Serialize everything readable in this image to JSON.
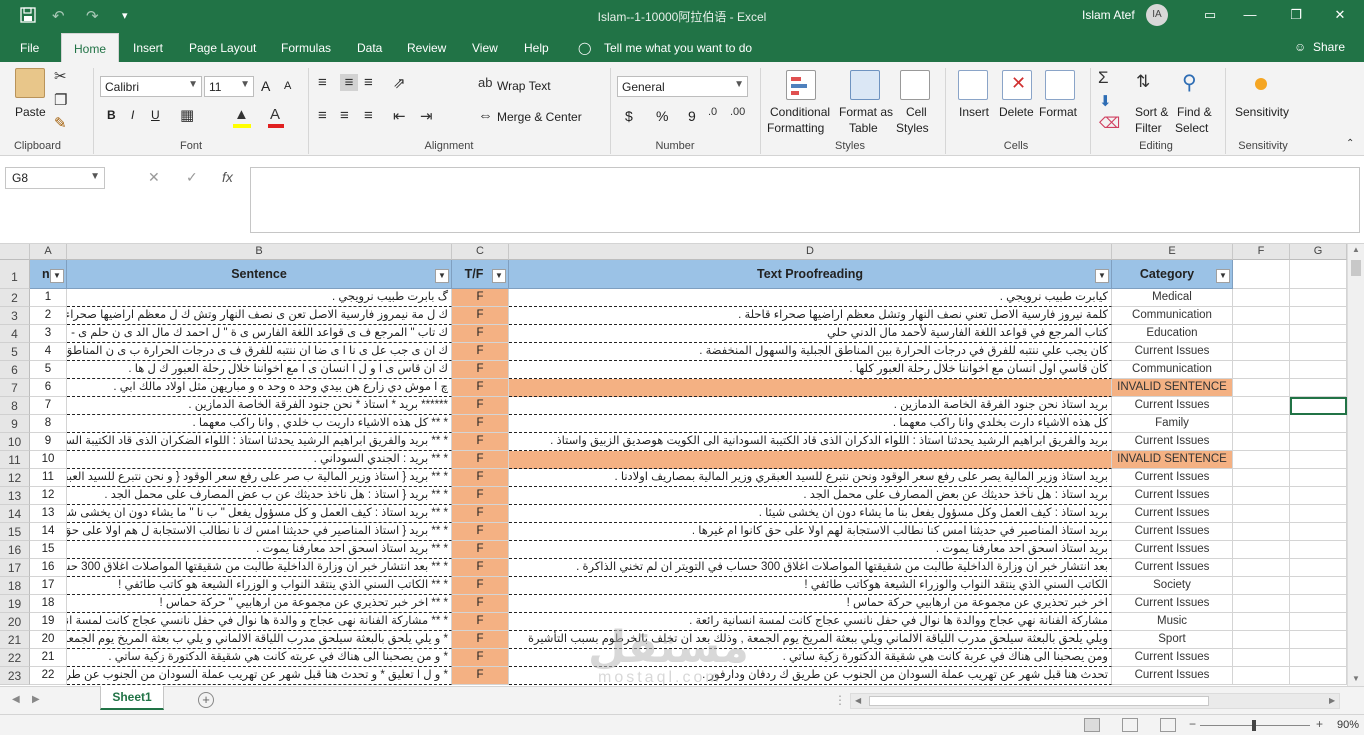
{
  "window": {
    "title": "Islam--1-10000阿拉伯语  -  Excel",
    "user": "Islam Atef",
    "avatar": "IA",
    "minimize": "—",
    "restore": "❐",
    "close": "✕",
    "ribbon_toggle": "▭"
  },
  "quick_access": {
    "save_icon": "save-icon",
    "undo": "↶",
    "redo": "↷",
    "more": "▾"
  },
  "tabs": [
    "File",
    "Home",
    "Insert",
    "Page Layout",
    "Formulas",
    "Data",
    "Review",
    "View",
    "Help"
  ],
  "tell_me": "Tell me what you want to do",
  "share": "Share",
  "ribbon": {
    "clipboard": {
      "paste": "Paste",
      "label": "Clipboard"
    },
    "font": {
      "name": "Calibri",
      "size": "11",
      "label": "Font",
      "bold": "B",
      "italic": "I",
      "underline": "U",
      "grow": "A",
      "shrink": "A"
    },
    "alignment": {
      "wrap": "Wrap Text",
      "merge": "Merge & Center",
      "label": "Alignment"
    },
    "number": {
      "format": "General",
      "currency": "$",
      "percent": "%",
      "comma": "9",
      "label": "Number"
    },
    "styles": {
      "conditional_1": "Conditional",
      "conditional_2": "Formatting",
      "format_table_1": "Format as",
      "format_table_2": "Table",
      "cell_styles_1": "Cell",
      "cell_styles_2": "Styles",
      "label": "Styles"
    },
    "cells": {
      "insert": "Insert",
      "delete": "Delete",
      "format": "Format",
      "label": "Cells"
    },
    "editing": {
      "sort_1": "Sort &",
      "sort_2": "Filter",
      "find_1": "Find &",
      "find_2": "Select",
      "label": "Editing"
    },
    "sensitivity": {
      "button": "Sensitivity",
      "label": "Sensitivity"
    }
  },
  "formula_bar": {
    "name_box": "G8",
    "cancel": "✕",
    "enter": "✓",
    "fx": "fx",
    "formula": ""
  },
  "columns": [
    "A",
    "B",
    "C",
    "D",
    "E",
    "F",
    "G"
  ],
  "table_headers": {
    "a": "n",
    "b": "Sentence",
    "c": "T/F",
    "d": "Text Proofreading",
    "e": "Category"
  },
  "row_numbers": [
    "1",
    "2",
    "3",
    "4",
    "5",
    "6",
    "7",
    "8",
    "9",
    "10",
    "11",
    "12",
    "13",
    "14",
    "15",
    "16",
    "17",
    "18",
    "19",
    "20",
    "21",
    "22",
    "23"
  ],
  "rows": [
    {
      "n": "1",
      "sentence": "گ بابرت طبيب نرويجي .",
      "tf": "F",
      "proof": "كيابرت طبيب نرويجي .",
      "category": "Medical"
    },
    {
      "n": "2",
      "sentence": "ك ل مة نيمروز فارسية الاصل تعن ى نصف النهار وتش ك ل معظم اراضيها صحراء قاحلة",
      "tf": "F",
      "proof": "كلمة نيروز فارسية الاصل تعني نصف النهار وتشل معظم اراضيها صحراء قاحلة .",
      "category": "Communication"
    },
    {
      "n": "3",
      "sentence": "ك تاب \" المرجع ف ى قواعد اللغة الفارس ى ة \" ل احمد ك مال الد ى ن حلم ى -",
      "tf": "F",
      "proof": "كتاب المرجع في قواعد اللغة الفارسية لأحمد مال الدني حلي",
      "category": "Education"
    },
    {
      "n": "4",
      "sentence": "ك ان ى جب عل ى نا ا ى ضا ان ننتبه للفرق ف ى درجات الحرارة ب ى ن المناطق الجبل",
      "tf": "F",
      "proof": "كان يجب علي ننتبه للفرق في درجات الحرارة بين المناطق الجبلية والسهول المنخفضة .",
      "category": "Current Issues"
    },
    {
      "n": "5",
      "sentence": "ك ان قاس ى ا و ل ا انسان ى ا مع اخواننا خلال رحلة العبور ك ل ها .",
      "tf": "F",
      "proof": "كان قاسي اول انسان مع اخواننا خلال رحلة العبور كلها .",
      "category": "Communication"
    },
    {
      "n": "6",
      "sentence": "چ ا موش دي زارع هن بيدي وحد ه وحد ه و مباريهن مثل اولاد مالك ابي .",
      "tf": "F",
      "proof": "",
      "category": "INVALID SENTENCE"
    },
    {
      "n": "7",
      "sentence": "****** بريد * استاذ * نحن جنود الفرقة الخاصة الدمازين .",
      "tf": "F",
      "proof": "بريد استاذ نحن جنود الفرقة الخاصة الدمازين .",
      "category": "Current Issues"
    },
    {
      "n": "8",
      "sentence": "* ** كل هذه الاشياء داريت ب خلدي , وانا راكب معهما .",
      "tf": "F",
      "proof": "كل هذه الاشياء دارت بخلدي وانا راكب معهما .",
      "category": "Family"
    },
    {
      "n": "9",
      "sentence": "* ** بريد والفريق ابراهيم الرشيد يحدثنا استاذ : اللواء الضكران الذى قاد الكتيبة السودانية ال",
      "tf": "F",
      "proof": "بريد والفريق ابراهيم الرشيد يحدثنا استاذ : اللواء الدكران الذى قاد الكتيبة السودانية الى الكويت هوصديق الزبيق واستاذ .",
      "category": "Current Issues"
    },
    {
      "n": "10",
      "sentence": "* ** بريد : الجندي السوداني .",
      "tf": "F",
      "proof": "",
      "category": "INVALID SENTENCE"
    },
    {
      "n": "11",
      "sentence": "* ** بريد { استاذ وزير المالية ب صر على رفع سعر الوقود { و نحن نتبرع للسيد العبقري وزير",
      "tf": "F",
      "proof": "بريد استاذ وزير المالية يصر على رفع سعر الوقود ونحن نتبرع للسيد العبقري وزير المالية بمصاريف اولادنا .",
      "category": "Current Issues"
    },
    {
      "n": "12",
      "sentence": "* ** بريد { استاذ : هل ناخذ حديثك عن ب عض المصارف على محمل الجد .",
      "tf": "F",
      "proof": "بريد استاذ : هل نأخذ حديثك عن بعض المصارف على محمل الجد .",
      "category": "Current Issues"
    },
    {
      "n": "13",
      "sentence": "* ** بريد استاذ : كيف العمل و كل مسؤول يفعل \" ب نا \" ما يشاء دون ان يخشى شيئا .",
      "tf": "F",
      "proof": "بريد استاذ : كيف العمل وكل مسؤول يفعل بنا ما يشاء دون ان يخشى شيئا .",
      "category": "Current Issues"
    },
    {
      "n": "14",
      "sentence": "* ** بريد { استاذ المناصير في حديثنا امس ك نا نطالب الاستجابة ل هم اولا على حق كانوا ام",
      "tf": "F",
      "proof": "بريد استاذ المناصير في حديثنا امس كنا نطالب الاستجابة لهم اولا على حق كانوا ام غيرها .",
      "category": "Current Issues"
    },
    {
      "n": "15",
      "sentence": "* ** بريد استاذ اسحق احد معارفنا يموت .",
      "tf": "F",
      "proof": "بريد استاذ اسحق احد معارفنا يموت .",
      "category": "Current Issues"
    },
    {
      "n": "16",
      "sentence": "* ** بعد انتشار خبر ان وزارة الداخلية طالبت من شقيقتها المواصلات اغلاق 300 حساب",
      "tf": "F",
      "proof": "بعد انتشار خبر ان وزارة الداخلية طالبت من شقيقتها المواصلات اغلاق 300 حساب في التويتر ان لم تخني الذاكرة .",
      "category": "Current Issues"
    },
    {
      "n": "17",
      "sentence": "* ** الكاتب السني الذي ينتقد النواب و الوزراء الشيعة هو كاتب طائفي !",
      "tf": "F",
      "proof": "الكاتب السني الذي ينتقد النواب والوزراء الشيعة هوكاتب طائفي !",
      "category": "Society"
    },
    {
      "n": "18",
      "sentence": "* ** اخر خبر تحذيري عن مجموعة من ارهابيي \" حركة حماس !",
      "tf": "F",
      "proof": "اخر خبر تحذيري عن مجموعة من ارهابيي حركة حماس !",
      "category": "Current Issues"
    },
    {
      "n": "19",
      "sentence": "* ** مشاركة الفنانة نهى عجاج و والدة ها نوال في حفل نانسي عجاج كانت لمسة انسانية رائعة",
      "tf": "F",
      "proof": "مشاركة الفنانة نهي عجاج ووالدة ها نوال في حفل نانسي عجاج كانت لمسة انسانية رائعة .",
      "category": "Music"
    },
    {
      "n": "20",
      "sentence": "* و يلي يلحق بالبعثة سيلحق مدرب اللياقة الالماني و يلي ب بعثة المريخ يوم الجمعة , و ذ",
      "tf": "F",
      "proof": "ويلي يلحق بالبعثة سيلحق مدرب اللياقة الالماني ويلي ببعثة المريخ يوم الجمعة , وذلك بعد ان تخلف بالخرطوم بسبب التأشيرة",
      "category": "Sport"
    },
    {
      "n": "21",
      "sentence": "* و من يصحبنا الى هناك في عربته كانت هي شقيقة الدكتورة زكية ساتي .",
      "tf": "F",
      "proof": "ومن يصحبنا الى هناك في عربة كانت هي شقيقة الدكتورة زكية ساتي .",
      "category": "Current Issues"
    },
    {
      "n": "22",
      "sentence": "* و ل ا تعليق * و تحدث هنا قبل شهر عن تهريب عملة السودان من الجنوب عن طريق ك ر",
      "tf": "F",
      "proof": "تحدث هنا قبل شهر عن تهريب عملة السودان من الجنوب عن طريق ك ردفان ودارفور .",
      "category": "Current Issues"
    }
  ],
  "sheet_tab": "Sheet1",
  "add_sheet": "+",
  "zoom": "90%",
  "watermark": {
    "line1": "مستقل",
    "line2": "mostaql.com"
  }
}
